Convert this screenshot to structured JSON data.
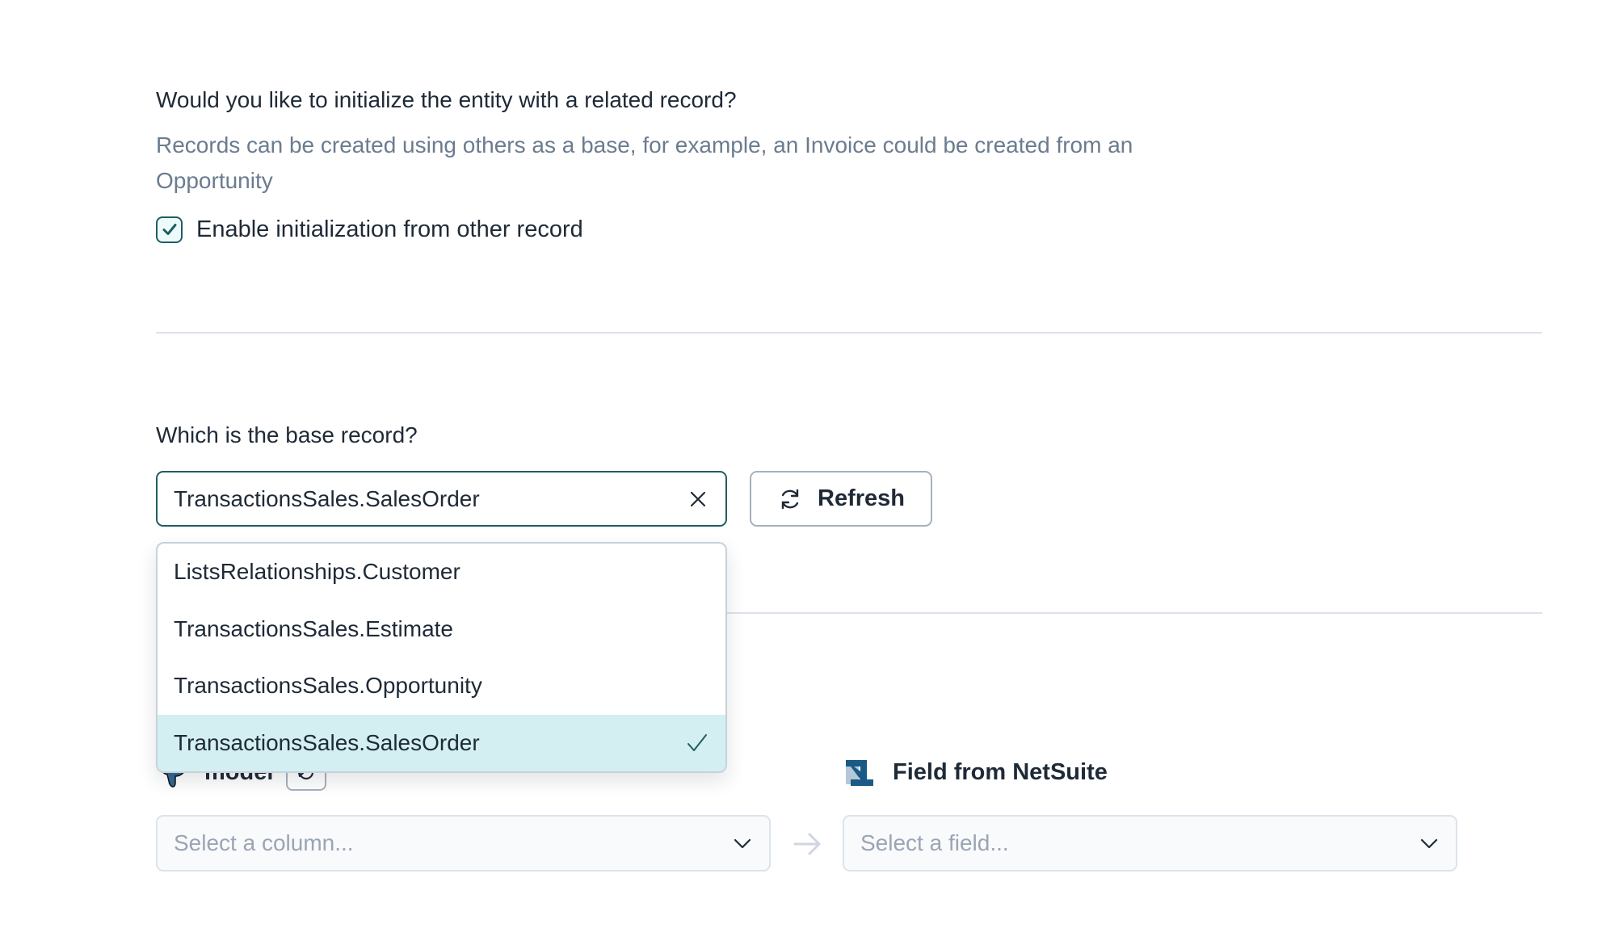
{
  "init_section": {
    "heading": "Would you like to initialize the entity with a related record?",
    "description": "Records can be created using others as a base, for example, an Invoice could be created from an Opportunity",
    "checkbox": {
      "label": "Enable initialization from other record",
      "checked": true
    }
  },
  "base_record": {
    "heading": "Which is the base record?",
    "combo": {
      "value": "TransactionsSales.SalesOrder",
      "clear_icon": "close-icon"
    },
    "refresh_button": {
      "label": "Refresh",
      "icon": "refresh-icon"
    },
    "dropdown": {
      "options": [
        {
          "label": "ListsRelationships.Customer",
          "selected": false
        },
        {
          "label": "TransactionsSales.Estimate",
          "selected": false
        },
        {
          "label": "TransactionsSales.Opportunity",
          "selected": false
        },
        {
          "label": "TransactionsSales.SalesOrder",
          "selected": true
        }
      ]
    }
  },
  "mapping": {
    "source": {
      "label": "model",
      "icon": "postgresql-icon",
      "refresh_icon": "refresh-icon",
      "placeholder": "Select a column..."
    },
    "target": {
      "label": "Field from NetSuite",
      "icon": "netsuite-icon",
      "placeholder": "Select a field..."
    },
    "arrow_icon": "arrow-right-icon"
  },
  "colors": {
    "accent": "#1e5e62",
    "selected_option_bg": "#d3eff1",
    "text": "#1f2a37",
    "muted_text": "#6b7c8f",
    "placeholder": "#9aa5b3",
    "divider": "#dde3ec"
  }
}
